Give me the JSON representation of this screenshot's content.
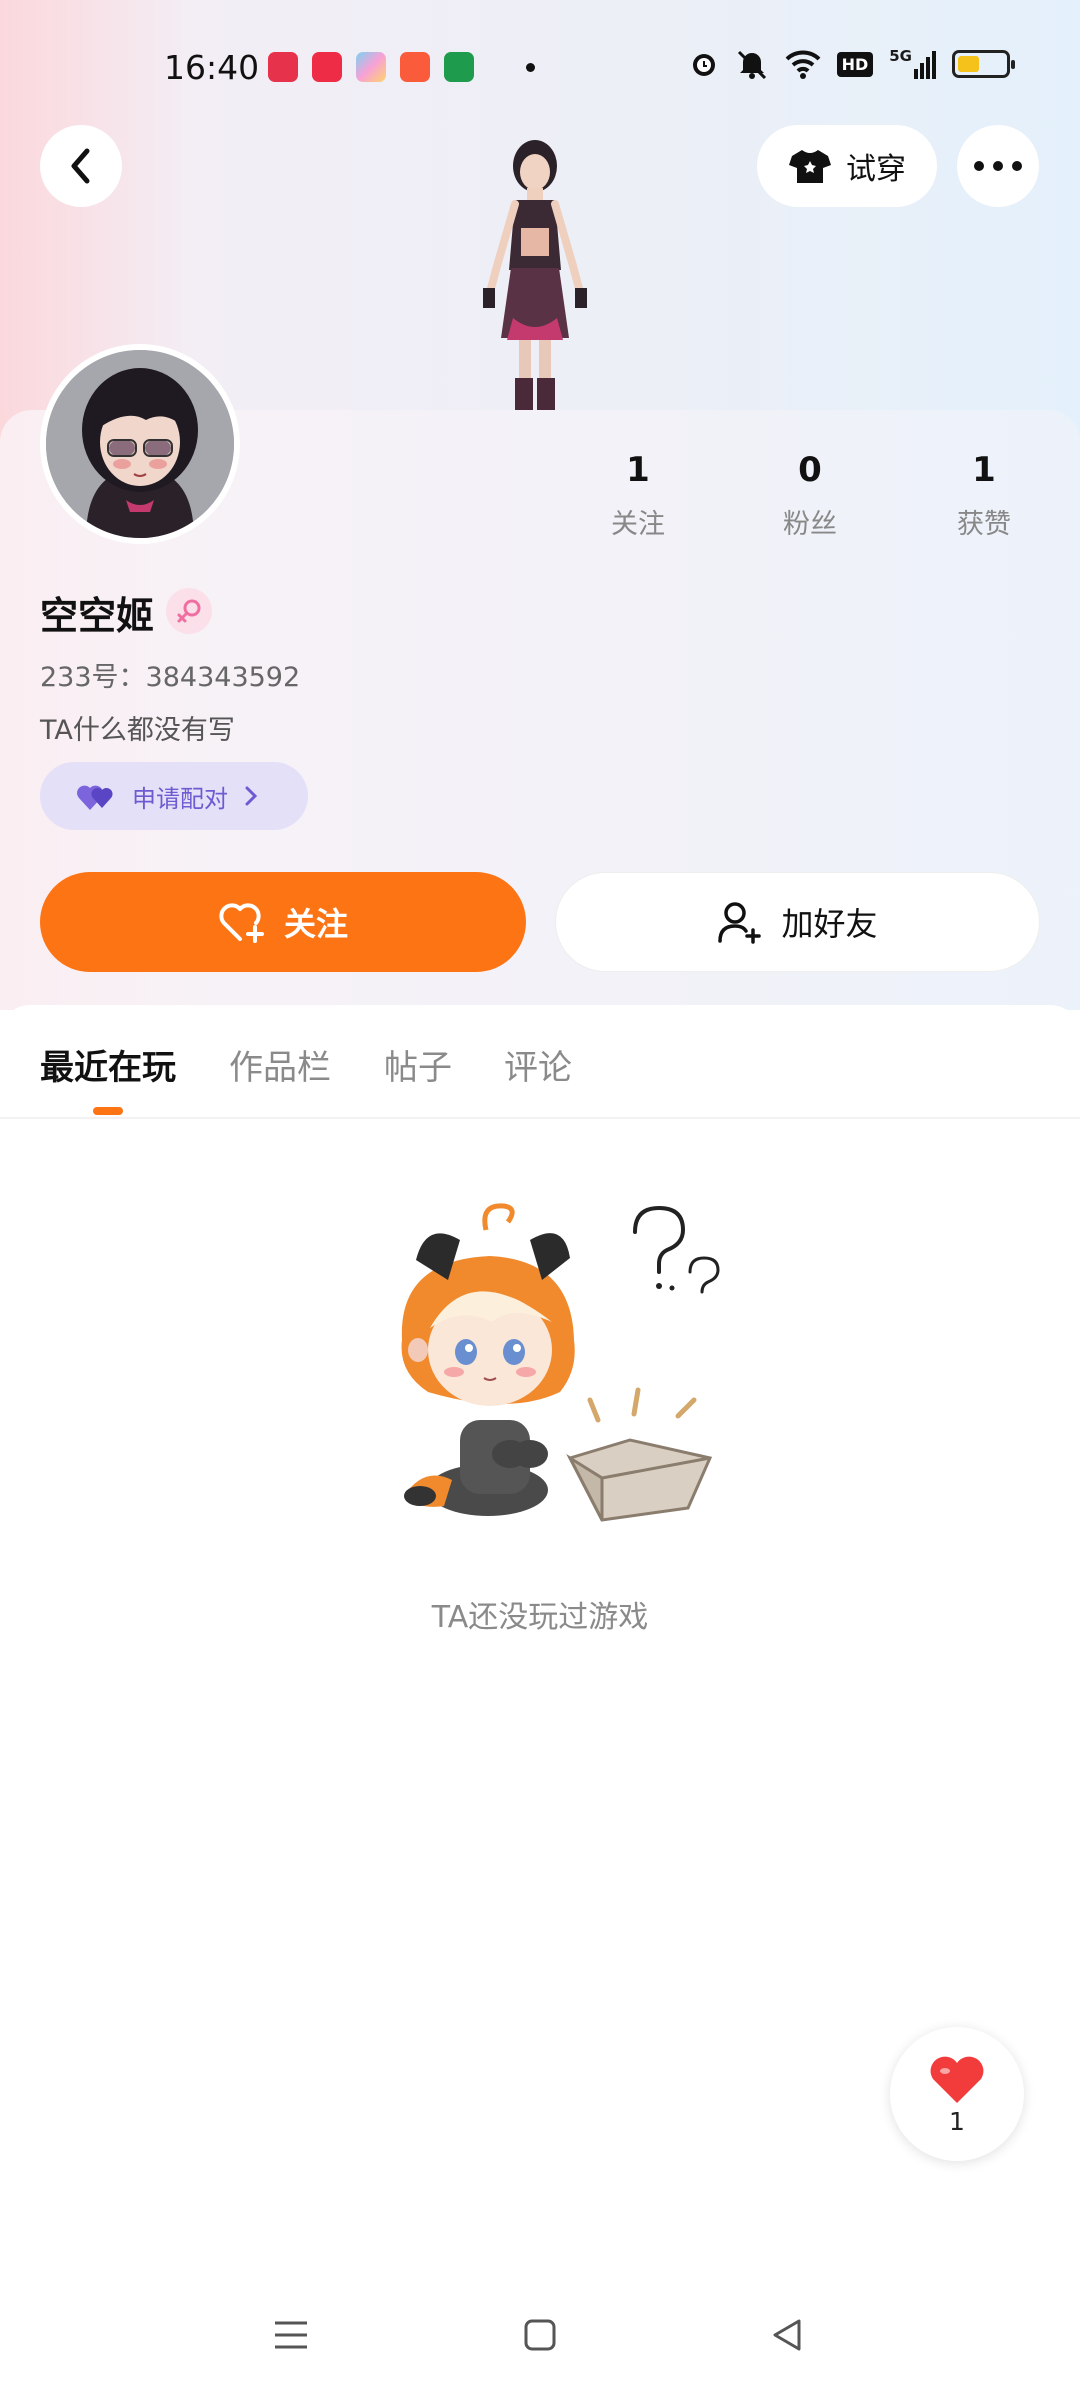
{
  "status_bar": {
    "time": "16:40",
    "app_icons": [
      "video-app-icon",
      "xiaohongshu-icon",
      "game-app-icon",
      "kuaishou-icon",
      "oppo-store-icon"
    ],
    "right_icons": [
      "alarm-icon",
      "mute-icon",
      "wifi-icon",
      "hd-icon",
      "signal-5g-icon",
      "battery-icon"
    ],
    "net_label": "HD",
    "net_type": "5G",
    "battery_level": 0.45
  },
  "header": {
    "try_on_label": "试穿"
  },
  "profile": {
    "nickname": "空空姬",
    "gender_icon": "female-icon",
    "uid_label": "233号：",
    "uid": "384343592",
    "bio": "TA什么都没有写",
    "pair_label": "申请配对",
    "stats": [
      {
        "value": "1",
        "label": "关注"
      },
      {
        "value": "0",
        "label": "粉丝"
      },
      {
        "value": "1",
        "label": "获赞"
      }
    ]
  },
  "actions": {
    "follow_label": "关注",
    "add_friend_label": "加好友"
  },
  "tabs": [
    {
      "label": "最近在玩",
      "active": true
    },
    {
      "label": "作品栏",
      "active": false
    },
    {
      "label": "帖子",
      "active": false
    },
    {
      "label": "评论",
      "active": false
    }
  ],
  "empty_state": {
    "text": "TA还没玩过游戏"
  },
  "like_fab": {
    "count": "1"
  },
  "colors": {
    "accent": "#fd7415",
    "pair_text": "#6f5bd1",
    "pair_bg": "#e4e0f8",
    "like_red": "#f23b3b"
  }
}
